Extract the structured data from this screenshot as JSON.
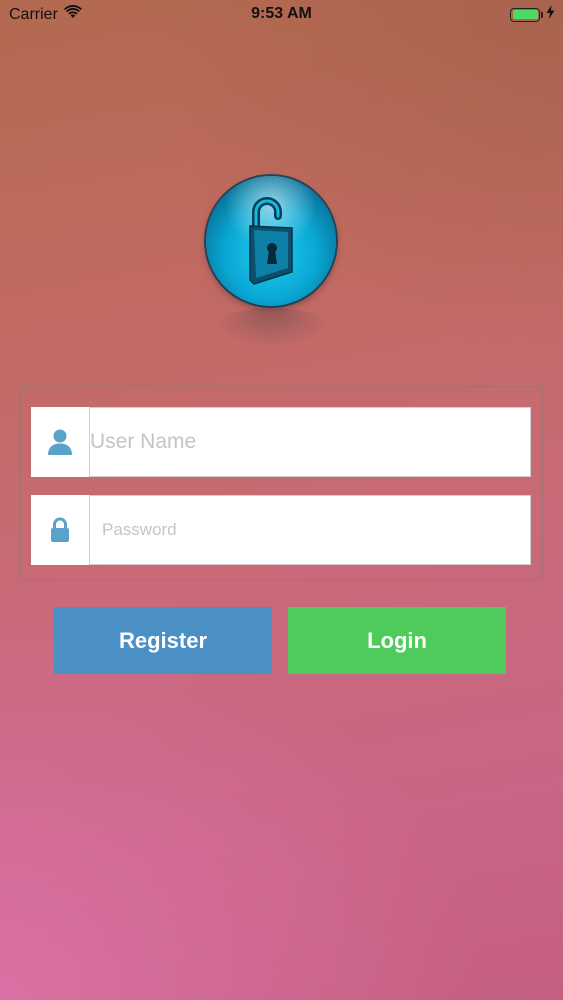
{
  "status_bar": {
    "carrier": "Carrier",
    "time": "9:53 AM",
    "battery_color": "#4cd964"
  },
  "logo": {
    "icon": "unlocked-padlock-icon"
  },
  "form": {
    "username": {
      "icon": "user-icon",
      "placeholder": "User Name",
      "value": ""
    },
    "password": {
      "icon": "lock-icon",
      "placeholder": "Password",
      "value": ""
    }
  },
  "actions": {
    "register_label": "Register",
    "register_color": "#4a90c5",
    "login_label": "Login",
    "login_color": "#4ecb5a"
  },
  "icon_color": "#5aa3c8"
}
